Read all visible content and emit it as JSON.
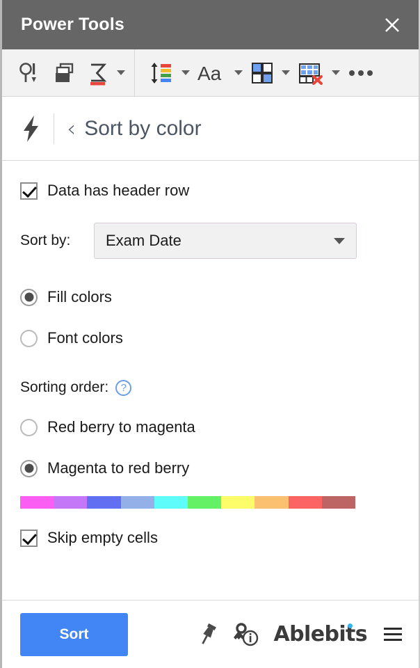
{
  "window": {
    "title": "Power Tools",
    "close_label": "×",
    "close_icon": "close-icon"
  },
  "toolbar": {
    "groups": [
      {
        "items": [
          {
            "icon": "find-and-replace-icon",
            "label": "Find and replace"
          },
          {
            "icon": "merge-sheets-icon",
            "label": "Merge sheets"
          },
          {
            "icon": "sum-sigma-icon",
            "label": "Sum by color",
            "has_caret": true
          }
        ]
      },
      {
        "items": [
          {
            "icon": "sort-by-color-icon",
            "label": "Sort",
            "has_caret": true
          },
          {
            "icon": "text-aa-icon",
            "label": "Text",
            "has_caret": true
          },
          {
            "icon": "randomize-cells-icon",
            "label": "Randomize",
            "has_caret": true
          },
          {
            "icon": "clear-table-icon",
            "label": "Clear",
            "has_caret": true
          },
          {
            "icon": "more-options-icon",
            "label": "More"
          }
        ]
      }
    ]
  },
  "section": {
    "logo_icon": "lightning-bolt-icon",
    "back_icon": "back-chevron-icon",
    "back_label": "‹",
    "title": "Sort by color"
  },
  "form": {
    "header_row": {
      "label": "Data has header row",
      "checked": true
    },
    "sort_by": {
      "label": "Sort by:",
      "value": "Exam Date",
      "placeholder": "Exam Date"
    },
    "color_type": {
      "options": [
        {
          "label": "Fill colors",
          "selected": true
        },
        {
          "label": "Font colors",
          "selected": false
        }
      ]
    },
    "sorting_order": {
      "label": "Sorting order:",
      "help_label": "?",
      "options": [
        {
          "label": "Red berry to magenta",
          "selected": false
        },
        {
          "label": "Magenta to red berry",
          "selected": true
        }
      ]
    },
    "color_preview": {
      "swatches": [
        "#fb5ef2",
        "#c478f7",
        "#6170f2",
        "#93b0e8",
        "#5ffcfc",
        "#64f165",
        "#fdfd69",
        "#fbc170",
        "#fc6464",
        "#bd6565"
      ]
    },
    "skip_empty": {
      "label": "Skip empty cells",
      "checked": true
    }
  },
  "footer": {
    "primary_button": "Sort",
    "primary_color": "#4285f4",
    "pin_icon": "pushpin-icon",
    "license_icon": "license-key-info-icon",
    "brand": "Ablebits",
    "brand_dot_color": "#35b5f0",
    "menu_icon": "hamburger-menu-icon"
  }
}
